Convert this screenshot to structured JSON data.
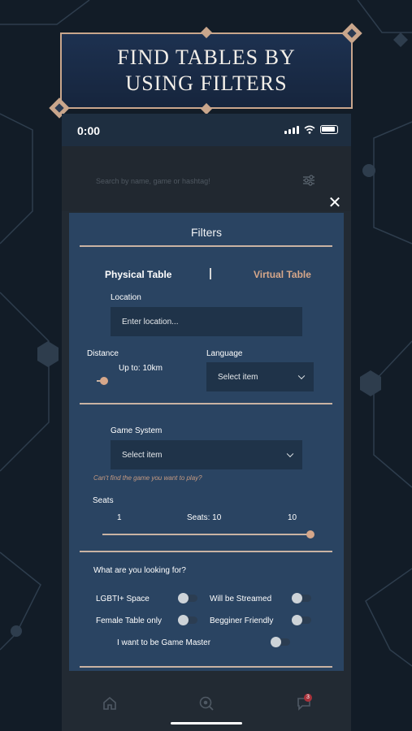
{
  "banner": {
    "title": "FIND TABLES BY USING FILTERS"
  },
  "status_bar": {
    "time": "0:00"
  },
  "search": {
    "placeholder": "Search by name, game or hashtag!"
  },
  "filters": {
    "title": "Filters",
    "tabs": [
      {
        "label": "Physical Table",
        "active": true
      },
      {
        "label": "Virtual Table",
        "active": false
      }
    ],
    "location": {
      "label": "Location",
      "placeholder": "Enter location..."
    },
    "distance": {
      "label": "Distance",
      "value_text": "Up to: 10km",
      "level": 0.0
    },
    "language": {
      "label": "Language",
      "selected": "Select item"
    },
    "game_system": {
      "label": "Game System",
      "selected": "Select item",
      "hint": "Can't find the game you want to play?"
    },
    "seats": {
      "label": "Seats",
      "min": "1",
      "value_text": "Seats: 10",
      "max": "10",
      "level": 1.0
    },
    "looking_for": {
      "label": "What are you looking for?",
      "options": [
        {
          "label": "LGBTI+ Space",
          "on": false
        },
        {
          "label": "Will be Streamed",
          "on": false
        },
        {
          "label": "Female Table only",
          "on": false
        },
        {
          "label": "Begginer Friendly",
          "on": false
        },
        {
          "label": "I want to be Game Master",
          "on": false
        }
      ]
    }
  },
  "nav": {
    "items": [
      "home-icon",
      "discover-icon",
      "chat-icon"
    ],
    "chat_badge": "3"
  },
  "colors": {
    "accent": "#c9a68c",
    "panel": "#2a4462",
    "field": "#1f3349",
    "tab_inactive": "#d6a78a"
  }
}
